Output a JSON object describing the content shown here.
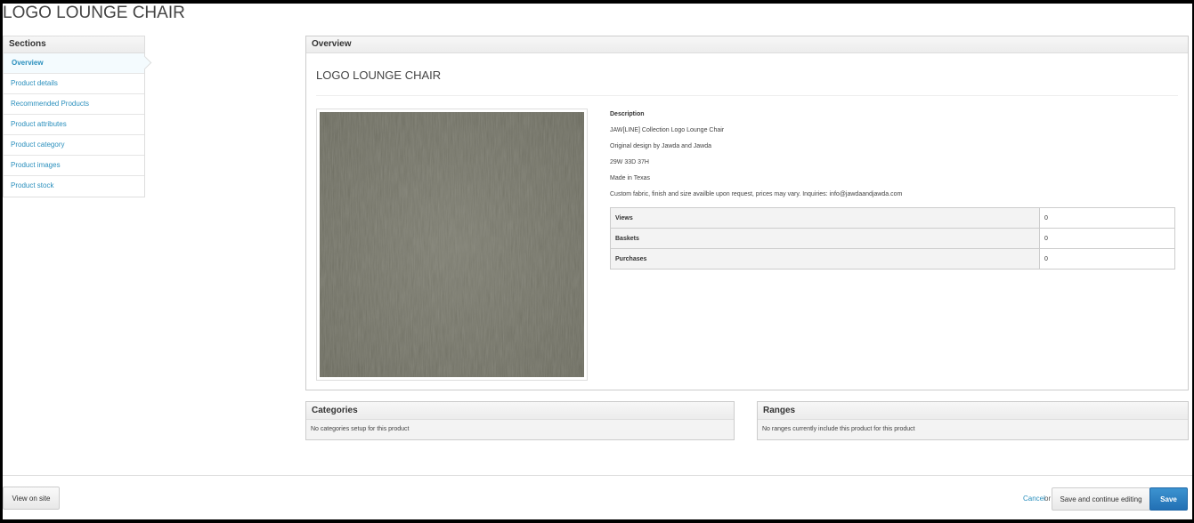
{
  "page": {
    "title": "LOGO LOUNGE CHAIR"
  },
  "sidebar": {
    "heading": "Sections",
    "items": [
      {
        "label": "Overview",
        "active": true
      },
      {
        "label": "Product details"
      },
      {
        "label": "Recommended Products"
      },
      {
        "label": "Product attributes"
      },
      {
        "label": "Product category"
      },
      {
        "label": "Product images"
      },
      {
        "label": "Product stock"
      }
    ]
  },
  "overview": {
    "heading": "Overview",
    "product_name": "LOGO LOUNGE CHAIR",
    "image": {
      "icon": "fabric-swatch-image",
      "color": "#7a7a6c"
    },
    "description_label": "Description",
    "description_lines": [
      "JAW[LINE] Collection Logo Lounge Chair",
      "Original design by Jawda and Jawda",
      "29W 33D 37H",
      "Made in Texas",
      "Custom fabric, finish and size availble upon request, prices may vary. Inquiries: info@jawdaandjawda.com"
    ],
    "stats": [
      {
        "label": "Views",
        "value": "0"
      },
      {
        "label": "Baskets",
        "value": "0"
      },
      {
        "label": "Purchases",
        "value": "0"
      }
    ]
  },
  "categories": {
    "heading": "Categories",
    "text": "No categories setup for this product"
  },
  "ranges": {
    "heading": "Ranges",
    "text": "No ranges currently include this product for this product"
  },
  "footer": {
    "view_on_site": "View on site",
    "cancel": "Cancel",
    "or": "or",
    "save_continue": "Save and continue editing",
    "save": "Save"
  },
  "colors": {
    "link": "#2a8fbd",
    "primary_button": "#2a78bd"
  }
}
